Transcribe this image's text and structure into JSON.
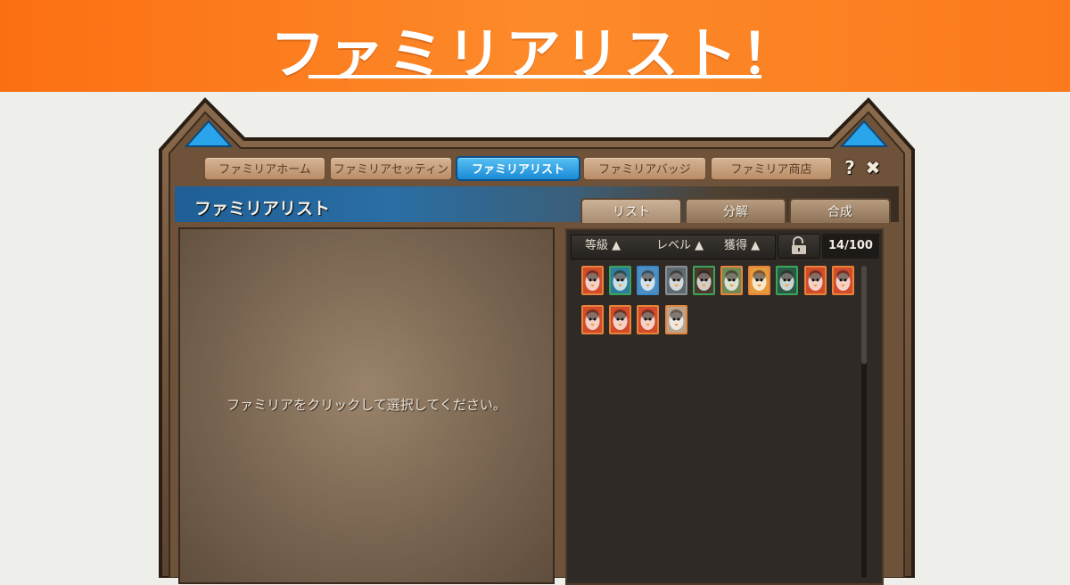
{
  "banner": {
    "title": "ファミリアリスト！"
  },
  "window": {
    "top_tabs": [
      {
        "label": "ファミリアホーム",
        "active": false
      },
      {
        "label": "ファミリアセッティング",
        "active": false
      },
      {
        "label": "ファミリアリスト",
        "active": true
      },
      {
        "label": "ファミリアバッジ",
        "active": false
      },
      {
        "label": "ファミリア商店",
        "active": false
      }
    ],
    "help_label": "?",
    "close_label": "✖",
    "header_title": "ファミリアリスト",
    "sub_tabs": [
      {
        "label": "リスト",
        "active": true
      },
      {
        "label": "分解",
        "active": false
      },
      {
        "label": "合成",
        "active": false
      }
    ],
    "detail_hint": "ファミリアをクリックして選択してください。",
    "sort_buttons": [
      {
        "label": "等級 ▲"
      },
      {
        "label": "レベル ▲"
      },
      {
        "label": "獲得 ▲"
      }
    ],
    "familiar_count": "14/100",
    "familiars": [
      {
        "name": "penguin",
        "frame": "#e8843a",
        "bg": "#d24b2b"
      },
      {
        "name": "mushroom",
        "frame": "#3aa55a",
        "bg": "#2f7d9c"
      },
      {
        "name": "blue-penguin",
        "frame": "#3a88c9",
        "bg": "#4c8fc0"
      },
      {
        "name": "snail",
        "frame": "#8a8f94",
        "bg": "#5d6a72"
      },
      {
        "name": "stump",
        "frame": "#3aa55a",
        "bg": "#4b3a2b"
      },
      {
        "name": "zombie",
        "frame": "#e8843a",
        "bg": "#6f8a55"
      },
      {
        "name": "orange-mushroom",
        "frame": "#e8843a",
        "bg": "#e59a3e"
      },
      {
        "name": "green-robot",
        "frame": "#3aa55a",
        "bg": "#2a5a46"
      },
      {
        "name": "penguin",
        "frame": "#e8843a",
        "bg": "#d24b2b"
      },
      {
        "name": "penguin",
        "frame": "#e8843a",
        "bg": "#d24b2b"
      },
      {
        "name": "penguin",
        "frame": "#e8843a",
        "bg": "#d24b2b"
      },
      {
        "name": "penguin",
        "frame": "#e8843a",
        "bg": "#d24b2b"
      },
      {
        "name": "penguin",
        "frame": "#e8843a",
        "bg": "#d24b2b"
      },
      {
        "name": "white-spirit",
        "frame": "#e8843a",
        "bg": "#b9a58e"
      }
    ]
  }
}
